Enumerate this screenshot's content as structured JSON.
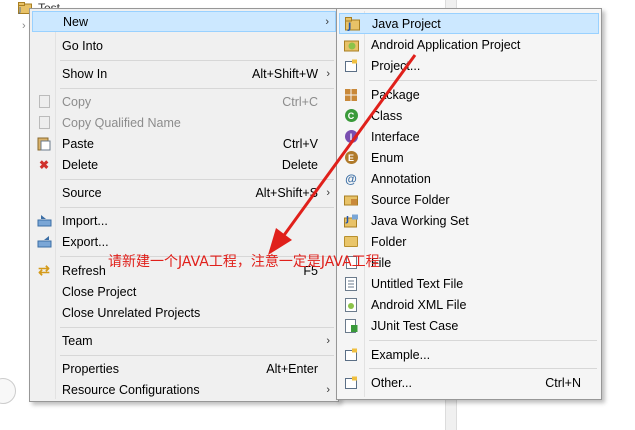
{
  "explorer": {
    "project_label": "Test"
  },
  "context_menu": {
    "items": [
      {
        "label": "New",
        "shortcut": "",
        "submenu": true,
        "icon": "none",
        "disabled": false,
        "highlighted": true
      },
      {
        "label": "Go Into",
        "shortcut": "",
        "submenu": false,
        "icon": "none",
        "disabled": false
      },
      {
        "label": "Show In",
        "shortcut": "Alt+Shift+W",
        "submenu": true,
        "icon": "none",
        "disabled": false
      },
      {
        "label": "Copy",
        "shortcut": "Ctrl+C",
        "submenu": false,
        "icon": "copy-icon",
        "disabled": true
      },
      {
        "label": "Copy Qualified Name",
        "shortcut": "",
        "submenu": false,
        "icon": "copy-qualified-icon",
        "disabled": true
      },
      {
        "label": "Paste",
        "shortcut": "Ctrl+V",
        "submenu": false,
        "icon": "paste-icon",
        "disabled": false
      },
      {
        "label": "Delete",
        "shortcut": "Delete",
        "submenu": false,
        "icon": "delete-icon",
        "disabled": false
      },
      {
        "label": "Source",
        "shortcut": "Alt+Shift+S",
        "submenu": true,
        "icon": "none",
        "disabled": false
      },
      {
        "label": "Import...",
        "shortcut": "",
        "submenu": false,
        "icon": "import-icon",
        "disabled": false
      },
      {
        "label": "Export...",
        "shortcut": "",
        "submenu": false,
        "icon": "export-icon",
        "disabled": false
      },
      {
        "label": "Refresh",
        "shortcut": "F5",
        "submenu": false,
        "icon": "refresh-icon",
        "disabled": false
      },
      {
        "label": "Close Project",
        "shortcut": "",
        "submenu": false,
        "icon": "none",
        "disabled": false
      },
      {
        "label": "Close Unrelated Projects",
        "shortcut": "",
        "submenu": false,
        "icon": "none",
        "disabled": false
      },
      {
        "label": "Team",
        "shortcut": "",
        "submenu": true,
        "icon": "none",
        "disabled": false
      },
      {
        "label": "Properties",
        "shortcut": "Alt+Enter",
        "submenu": false,
        "icon": "none",
        "disabled": false
      },
      {
        "label": "Resource Configurations",
        "shortcut": "",
        "submenu": true,
        "icon": "none",
        "disabled": false
      }
    ]
  },
  "new_submenu": {
    "items": [
      {
        "label": "Java Project",
        "shortcut": "",
        "icon": "java-project-icon",
        "highlighted": true
      },
      {
        "label": "Android Application Project",
        "shortcut": "",
        "icon": "android-project-icon"
      },
      {
        "label": "Project...",
        "shortcut": "",
        "icon": "project-icon"
      },
      {
        "label": "Package",
        "shortcut": "",
        "icon": "package-icon"
      },
      {
        "label": "Class",
        "shortcut": "",
        "icon": "class-icon"
      },
      {
        "label": "Interface",
        "shortcut": "",
        "icon": "interface-icon"
      },
      {
        "label": "Enum",
        "shortcut": "",
        "icon": "enum-icon"
      },
      {
        "label": "Annotation",
        "shortcut": "",
        "icon": "annotation-icon"
      },
      {
        "label": "Source Folder",
        "shortcut": "",
        "icon": "source-folder-icon"
      },
      {
        "label": "Java Working Set",
        "shortcut": "",
        "icon": "working-set-icon"
      },
      {
        "label": "Folder",
        "shortcut": "",
        "icon": "folder-icon"
      },
      {
        "label": "File",
        "shortcut": "",
        "icon": "file-icon"
      },
      {
        "label": "Untitled Text File",
        "shortcut": "",
        "icon": "text-file-icon"
      },
      {
        "label": "Android XML File",
        "shortcut": "",
        "icon": "android-xml-icon"
      },
      {
        "label": "JUnit Test Case",
        "shortcut": "",
        "icon": "junit-icon"
      },
      {
        "label": "Example...",
        "shortcut": "",
        "icon": "example-icon"
      },
      {
        "label": "Other...",
        "shortcut": "Ctrl+N",
        "icon": "other-icon"
      }
    ]
  },
  "annotation": {
    "text": "请新建一个JAVA工程，注意一定是JAVA工程",
    "color": "#e0201b"
  },
  "colors": {
    "highlight": "#cce8ff",
    "menu_bg": "#f0f0f0"
  }
}
